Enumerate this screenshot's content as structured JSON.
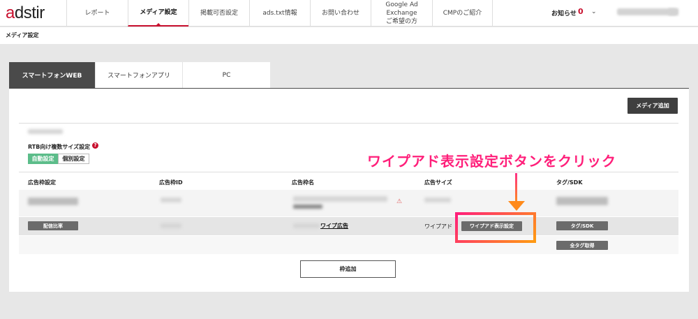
{
  "header": {
    "logo_first": "a",
    "logo_rest": "dstir",
    "nav": [
      {
        "label": "レポート"
      },
      {
        "label": "メディア設定"
      },
      {
        "label": "掲載可否設定"
      },
      {
        "label": "ads.txt情報"
      },
      {
        "label": "お問い合わせ"
      },
      {
        "label_line1": "Google Ad",
        "label_line2": "Exchange",
        "label_line3": "ご希望の方"
      },
      {
        "label": "CMPのご紹介"
      }
    ],
    "notice_label": "お知らせ",
    "notice_count": "0",
    "chevron": "⌄"
  },
  "breadcrumb": "メディア設定",
  "tabs": [
    {
      "label": "スマートフォンWEB"
    },
    {
      "label": "スマートフォンアプリ"
    },
    {
      "label": "PC"
    }
  ],
  "media_add_label": "メディア追加",
  "rtb": {
    "label": "RTB向け複数サイズ設定",
    "help": "?",
    "auto_label": "自動設定",
    "individual_label": "個別設定"
  },
  "table": {
    "headers": [
      "広告枠設定",
      "広告枠ID",
      "広告枠名",
      "広告サイズ",
      "タグ/SDK"
    ],
    "row2": {
      "distribution_label": "配信比率",
      "name_suffix": "ワイプ広告",
      "size": "ワイプアド",
      "wipe_button_label": "ワイプアド表示設定",
      "tag_button_label": "タグ/SDK",
      "all_tags_label": "全タグ取得"
    }
  },
  "add_frame_label": "枠追加",
  "annotation": {
    "text": "ワイプアド表示設定ボタンをクリック"
  },
  "colors": {
    "brand": "#c8102e",
    "annotation_pink": "#ff1f7a",
    "annotation_orange": "#ff9a12",
    "auto_green": "#5cbd8a"
  }
}
